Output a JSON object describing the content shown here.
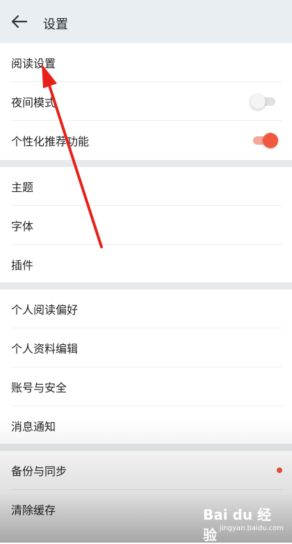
{
  "header": {
    "title": "设置",
    "back_icon": "arrow-left-icon"
  },
  "group1": {
    "reading_settings": "阅读设置",
    "night_mode": {
      "label": "夜间模式",
      "state": "off"
    },
    "personalized_recommendation": {
      "label": "个性化推荐功能",
      "state": "on"
    }
  },
  "group2": {
    "theme": "主题",
    "font": "字体",
    "plugins": "插件"
  },
  "group3": {
    "reading_preference": "个人阅读偏好",
    "profile_edit": "个人资料编辑",
    "account_security": "账号与安全",
    "notifications": "消息通知"
  },
  "group4": {
    "backup_sync": "备份与同步",
    "clear_cache": "清除缓存"
  },
  "colors": {
    "accent": "#f0583f",
    "header_bg": "#e8eef2",
    "divider_gap": "#e6eaec"
  },
  "watermark": {
    "brand": "Bai du 经验",
    "url": "jingyan.baidu.com"
  }
}
